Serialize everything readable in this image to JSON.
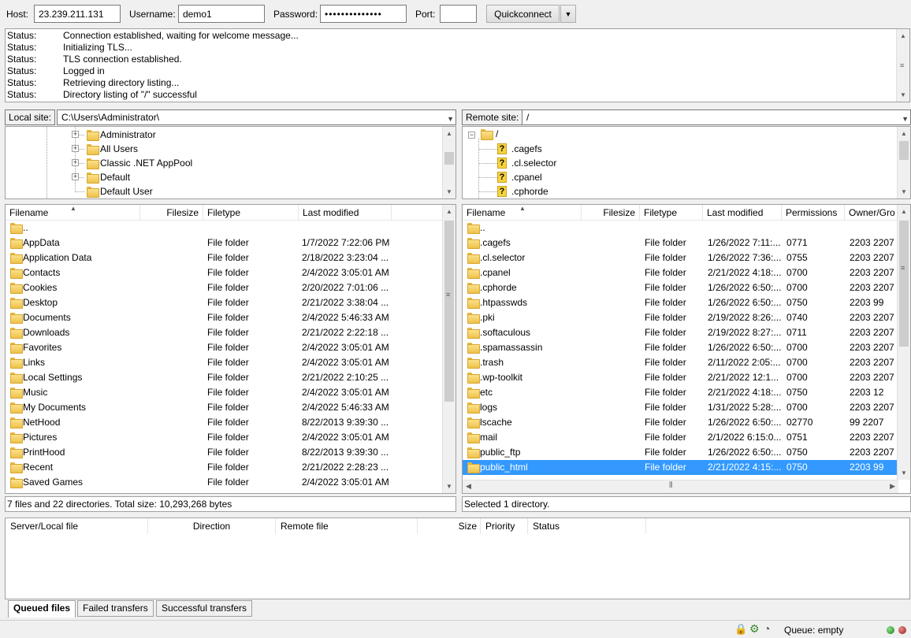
{
  "quickconnect": {
    "host_label": "Host:",
    "host_value": "23.239.211.131",
    "username_label": "Username:",
    "username_value": "demo1",
    "password_label": "Password:",
    "password_value": "••••••••••••••",
    "port_label": "Port:",
    "port_value": "",
    "connect_label": "Quickconnect",
    "dropdown_icon": "chevron-down-icon"
  },
  "log": [
    {
      "key": "Status:",
      "msg": "Connection established, waiting for welcome message..."
    },
    {
      "key": "Status:",
      "msg": "Initializing TLS..."
    },
    {
      "key": "Status:",
      "msg": "TLS connection established."
    },
    {
      "key": "Status:",
      "msg": "Logged in"
    },
    {
      "key": "Status:",
      "msg": "Retrieving directory listing..."
    },
    {
      "key": "Status:",
      "msg": "Directory listing of \"/\" successful"
    }
  ],
  "local": {
    "site_label": "Local site:",
    "path": "C:\\Users\\Administrator\\",
    "tree": [
      "Administrator",
      "All Users",
      "Classic .NET AppPool",
      "Default",
      "Default User"
    ],
    "headers": {
      "filename": "Filename",
      "filesize": "Filesize",
      "filetype": "Filetype",
      "modified": "Last modified"
    },
    "rows": [
      {
        "name": "..",
        "type": "",
        "date": "",
        "icon": "folder-icon"
      },
      {
        "name": "AppData",
        "type": "File folder",
        "date": "1/7/2022 7:22:06 PM",
        "icon": "folder-icon"
      },
      {
        "name": "Application Data",
        "type": "File folder",
        "date": "2/18/2022 3:23:04 ...",
        "icon": "folder-icon"
      },
      {
        "name": "Contacts",
        "type": "File folder",
        "date": "2/4/2022 3:05:01 AM",
        "icon": "contacts-folder-icon"
      },
      {
        "name": "Cookies",
        "type": "File folder",
        "date": "2/20/2022 7:01:06 ...",
        "icon": "folder-icon"
      },
      {
        "name": "Desktop",
        "type": "File folder",
        "date": "2/21/2022 3:38:04 ...",
        "icon": "desktop-icon"
      },
      {
        "name": "Documents",
        "type": "File folder",
        "date": "2/4/2022 5:46:33 AM",
        "icon": "documents-folder-icon"
      },
      {
        "name": "Downloads",
        "type": "File folder",
        "date": "2/21/2022 2:22:18 ...",
        "icon": "downloads-folder-icon"
      },
      {
        "name": "Favorites",
        "type": "File folder",
        "date": "2/4/2022 3:05:01 AM",
        "icon": "favorites-folder-icon"
      },
      {
        "name": "Links",
        "type": "File folder",
        "date": "2/4/2022 3:05:01 AM",
        "icon": "links-folder-icon"
      },
      {
        "name": "Local Settings",
        "type": "File folder",
        "date": "2/21/2022 2:10:25 ...",
        "icon": "folder-icon"
      },
      {
        "name": "Music",
        "type": "File folder",
        "date": "2/4/2022 3:05:01 AM",
        "icon": "music-folder-icon"
      },
      {
        "name": "My Documents",
        "type": "File folder",
        "date": "2/4/2022 5:46:33 AM",
        "icon": "folder-icon"
      },
      {
        "name": "NetHood",
        "type": "File folder",
        "date": "8/22/2013 9:39:30 ...",
        "icon": "folder-icon"
      },
      {
        "name": "Pictures",
        "type": "File folder",
        "date": "2/4/2022 3:05:01 AM",
        "icon": "pictures-folder-icon"
      },
      {
        "name": "PrintHood",
        "type": "File folder",
        "date": "8/22/2013 9:39:30 ...",
        "icon": "folder-icon"
      },
      {
        "name": "Recent",
        "type": "File folder",
        "date": "2/21/2022 2:28:23 ...",
        "icon": "folder-icon"
      },
      {
        "name": "Saved Games",
        "type": "File folder",
        "date": "2/4/2022 3:05:01 AM",
        "icon": "saved-games-icon"
      }
    ],
    "status": "7 files and 22 directories. Total size: 10,293,268 bytes"
  },
  "remote": {
    "site_label": "Remote site:",
    "path": "/",
    "tree_root": "/",
    "tree": [
      ".cagefs",
      ".cl.selector",
      ".cpanel",
      ".cphorde"
    ],
    "headers": {
      "filename": "Filename",
      "filesize": "Filesize",
      "filetype": "Filetype",
      "modified": "Last modified",
      "permissions": "Permissions",
      "owner": "Owner/Gro"
    },
    "rows": [
      {
        "name": "..",
        "type": "",
        "date": "",
        "perm": "",
        "owner": ""
      },
      {
        "name": ".cagefs",
        "type": "File folder",
        "date": "1/26/2022 7:11:...",
        "perm": "0771",
        "owner": "2203 2207"
      },
      {
        "name": ".cl.selector",
        "type": "File folder",
        "date": "1/26/2022 7:36:...",
        "perm": "0755",
        "owner": "2203 2207"
      },
      {
        "name": ".cpanel",
        "type": "File folder",
        "date": "2/21/2022 4:18:...",
        "perm": "0700",
        "owner": "2203 2207"
      },
      {
        "name": ".cphorde",
        "type": "File folder",
        "date": "1/26/2022 6:50:...",
        "perm": "0700",
        "owner": "2203 2207"
      },
      {
        "name": ".htpasswds",
        "type": "File folder",
        "date": "1/26/2022 6:50:...",
        "perm": "0750",
        "owner": "2203 99"
      },
      {
        "name": ".pki",
        "type": "File folder",
        "date": "2/19/2022 8:26:...",
        "perm": "0740",
        "owner": "2203 2207"
      },
      {
        "name": ".softaculous",
        "type": "File folder",
        "date": "2/19/2022 8:27:...",
        "perm": "0711",
        "owner": "2203 2207"
      },
      {
        "name": ".spamassassin",
        "type": "File folder",
        "date": "1/26/2022 6:50:...",
        "perm": "0700",
        "owner": "2203 2207"
      },
      {
        "name": ".trash",
        "type": "File folder",
        "date": "2/11/2022 2:05:...",
        "perm": "0700",
        "owner": "2203 2207"
      },
      {
        "name": ".wp-toolkit",
        "type": "File folder",
        "date": "2/21/2022 12:1...",
        "perm": "0700",
        "owner": "2203 2207"
      },
      {
        "name": "etc",
        "type": "File folder",
        "date": "2/21/2022 4:18:...",
        "perm": "0750",
        "owner": "2203 12"
      },
      {
        "name": "logs",
        "type": "File folder",
        "date": "1/31/2022 5:28:...",
        "perm": "0700",
        "owner": "2203 2207"
      },
      {
        "name": "lscache",
        "type": "File folder",
        "date": "1/26/2022 6:50:...",
        "perm": "02770",
        "owner": "99 2207"
      },
      {
        "name": "mail",
        "type": "File folder",
        "date": "2/1/2022 6:15:0...",
        "perm": "0751",
        "owner": "2203 2207"
      },
      {
        "name": "public_ftp",
        "type": "File folder",
        "date": "1/26/2022 6:50:...",
        "perm": "0750",
        "owner": "2203 2207"
      },
      {
        "name": "public_html",
        "type": "File folder",
        "date": "2/21/2022 4:15:...",
        "perm": "0750",
        "owner": "2203 99"
      }
    ],
    "status": "Selected 1 directory."
  },
  "queue": {
    "headers": {
      "server": "Server/Local file",
      "direction": "Direction",
      "remote": "Remote file",
      "size": "Size",
      "priority": "Priority",
      "status": "Status"
    },
    "tabs": {
      "queued": "Queued files",
      "failed": "Failed transfers",
      "successful": "Successful transfers"
    }
  },
  "statusbar": {
    "queue_text": "Queue: empty"
  },
  "colors": {
    "selection": "#3399ff",
    "folder": "#eec24a"
  }
}
